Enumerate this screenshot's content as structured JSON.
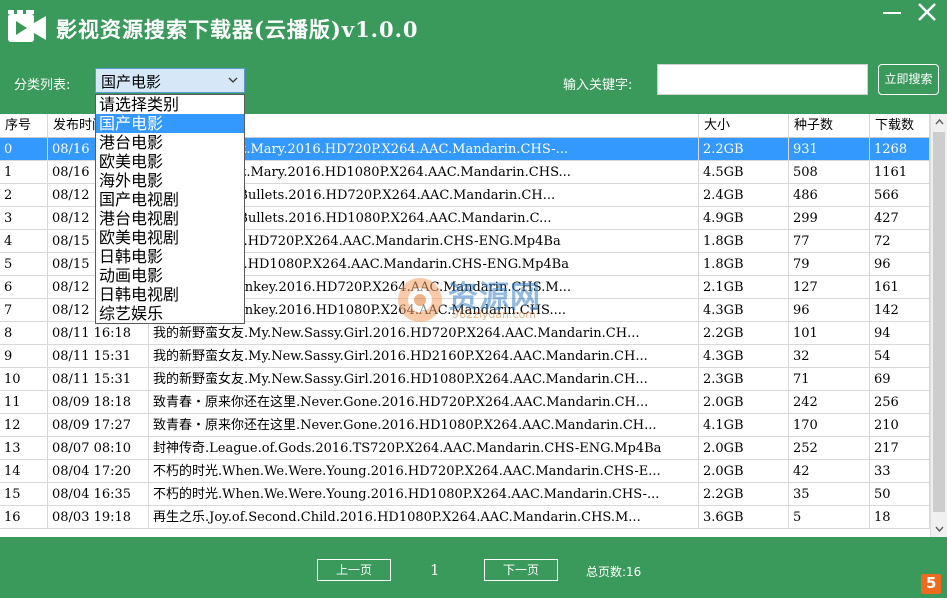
{
  "app": {
    "title": "影视资源搜索下载器(云播版)v1.0.0",
    "accent_color": "#3a9a5b",
    "icons": [
      "video-camera-icon",
      "minimize-icon",
      "close-icon"
    ]
  },
  "toolbar": {
    "category_label": "分类列表:",
    "category_selected": "国产电影",
    "keyword_label": "输入关键字:",
    "keyword_value": "",
    "search_button": "立即搜索"
  },
  "dropdown": {
    "options": [
      "请选择类别",
      "国产电影",
      "港台电影",
      "欧美电影",
      "海外电影",
      "国产电视剧",
      "港台电视剧",
      "欧美电视剧",
      "日韩电影",
      "动画电影",
      "日韩电视剧",
      "综艺娱乐"
    ],
    "selected_index": 1
  },
  "table": {
    "columns": [
      "序号",
      "发布时间",
      "",
      "大小",
      "种子数",
      "下载数"
    ],
    "selected_row": 0,
    "rows": [
      [
        "0",
        "08/16",
        "hen.Larry.Met.Mary.2016.HD720P.X264.AAC.Mandarin.CHS-...",
        "2.2GB",
        "931",
        "1268"
      ],
      [
        "1",
        "08/16",
        "hen.Larry.Met.Mary.2016.HD1080P.X264.AAC.Mandarin.CHS...",
        "4.5GB",
        "508",
        "1161"
      ],
      [
        "2",
        "08/12",
        "手.For.A.Few.Bullets.2016.HD720P.X264.AAC.Mandarin.CH...",
        "2.4GB",
        "486",
        "566"
      ],
      [
        "3",
        "08/12",
        "手.For.A.Few.Bullets.2016.HD1080P.X264.AAC.Mandarin.C...",
        "4.9GB",
        "299",
        "427"
      ],
      [
        "4",
        "08/15",
        "Whisper.2016.HD720P.X264.AAC.Mandarin.CHS-ENG.Mp4Ba",
        "1.8GB",
        "77",
        "72"
      ],
      [
        "5",
        "08/15",
        "Whisper.2016.HD1080P.X264.AAC.Mandarin.CHS-ENG.Mp4Ba",
        "1.8GB",
        "79",
        "96"
      ],
      [
        "6",
        "08/12",
        "lowing.the.Donkey.2016.HD720P.X264.AAC.Mandarin.CHS.M...",
        "2.1GB",
        "127",
        "161"
      ],
      [
        "7",
        "08/12",
        "lowing.the.Donkey.2016.HD1080P.X264.AAC.Mandarin.CHS....",
        "4.3GB",
        "96",
        "142"
      ],
      [
        "8",
        "08/11 16:18",
        "我的新野蛮女友.My.New.Sassy.Girl.2016.HD720P.X264.AAC.Mandarin.CH...",
        "2.2GB",
        "101",
        "94"
      ],
      [
        "9",
        "08/11 15:31",
        "我的新野蛮女友.My.New.Sassy.Girl.2016.HD2160P.X264.AAC.Mandarin.CH...",
        "4.3GB",
        "32",
        "54"
      ],
      [
        "10",
        "08/11 15:31",
        "我的新野蛮女友.My.New.Sassy.Girl.2016.HD1080P.X264.AAC.Mandarin.CH...",
        "2.3GB",
        "71",
        "69"
      ],
      [
        "11",
        "08/09 18:18",
        "致青春・原来你还在这里.Never.Gone.2016.HD720P.X264.AAC.Mandarin.CH...",
        "2.0GB",
        "242",
        "256"
      ],
      [
        "12",
        "08/09 17:27",
        "致青春・原来你还在这里.Never.Gone.2016.HD1080P.X264.AAC.Mandarin.CH...",
        "4.1GB",
        "170",
        "210"
      ],
      [
        "13",
        "08/07 08:10",
        "封神传奇.League.of.Gods.2016.TS720P.X264.AAC.Mandarin.CHS-ENG.Mp4Ba",
        "2.0GB",
        "252",
        "217"
      ],
      [
        "14",
        "08/04 17:20",
        "不朽的时光.When.We.Were.Young.2016.HD720P.X264.AAC.Mandarin.CHS-E...",
        "2.0GB",
        "42",
        "33"
      ],
      [
        "15",
        "08/04 16:35",
        "不朽的时光.When.We.Were.Young.2016.HD1080P.X264.AAC.Mandarin.CHS-...",
        "2.2GB",
        "35",
        "50"
      ],
      [
        "16",
        "08/03 19:18",
        "再生之乐.Joy.of.Second.Child.2016.HD1080P.X264.AAC.Mandarin.CHS.M...",
        "3.6GB",
        "5",
        "18"
      ]
    ]
  },
  "watermark": {
    "text": "资源网",
    "sub": "962ziyuan.com"
  },
  "pagination": {
    "prev": "上一页",
    "current": "1",
    "next": "下一页",
    "total_label": "总页数:16"
  },
  "corner_logo": "5"
}
